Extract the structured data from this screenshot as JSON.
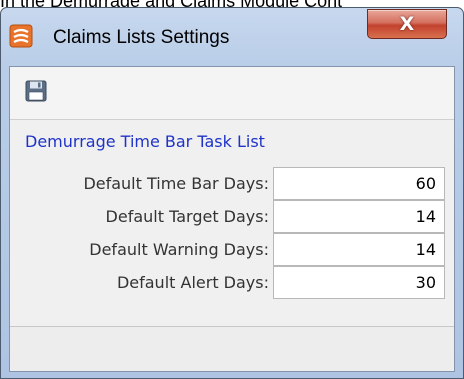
{
  "caption": "In the Demurrage and Claims Module Cont",
  "window": {
    "title": "Claims Lists Settings",
    "close_label": "X"
  },
  "toolbar": {
    "save_icon": "save-icon"
  },
  "section": {
    "title": "Demurrage Time Bar Task List"
  },
  "fields": [
    {
      "label": "Default Time Bar Days:",
      "value": "60"
    },
    {
      "label": "Default Target Days:",
      "value": "14"
    },
    {
      "label": "Default Warning Days:",
      "value": "14"
    },
    {
      "label": "Default Alert Days:",
      "value": "30"
    }
  ],
  "colors": {
    "section_title": "#1f33c8",
    "close_button": "#c2422e",
    "titlebar": "#b9cde8",
    "app_icon": "#e8732a"
  }
}
